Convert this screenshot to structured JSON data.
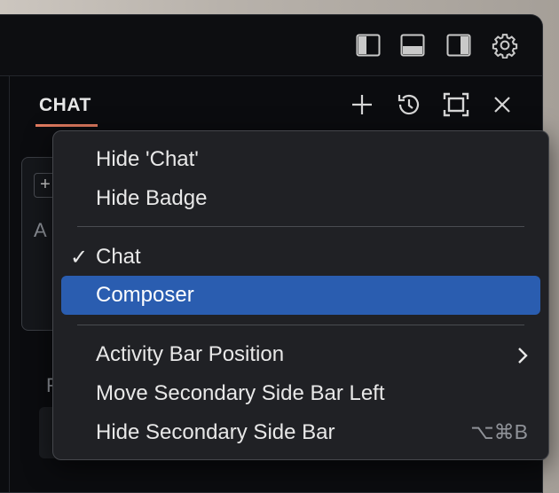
{
  "panel": {
    "tab_label": "CHAT",
    "background_partial_text": [
      "A",
      "F"
    ]
  },
  "titlebar_icons": [
    "toggle-primary-sidebar-icon",
    "toggle-panel-icon",
    "toggle-secondary-sidebar-icon",
    "settings-gear-icon"
  ],
  "panel_icons": [
    "new-chat-plus-icon",
    "history-icon",
    "maximize-icon",
    "close-icon"
  ],
  "menu": {
    "items": [
      {
        "label": "Hide 'Chat'"
      },
      {
        "label": "Hide Badge"
      },
      {
        "label": "Chat",
        "checked": true
      },
      {
        "label": "Composer",
        "highlighted": true
      },
      {
        "label": "Activity Bar Position",
        "submenu": true
      },
      {
        "label": "Move Secondary Side Bar Left"
      },
      {
        "label": "Hide Secondary Side Bar",
        "shortcut": "⌥⌘B"
      }
    ],
    "check_glyph": "✓"
  },
  "colors": {
    "accent_underline": "#e07a5f",
    "selection": "#2a5db0",
    "menu_bg": "#202125",
    "window_bg": "#0b0c0f"
  }
}
